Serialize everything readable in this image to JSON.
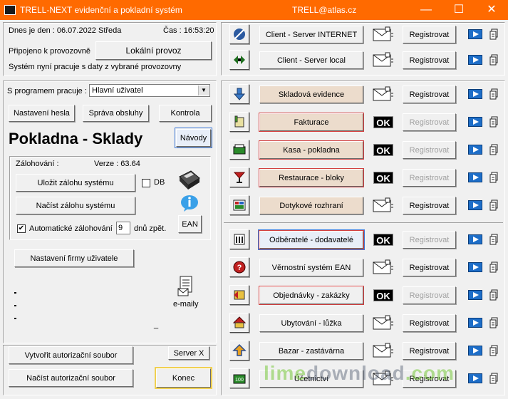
{
  "titlebar": {
    "title": "TRELL-NEXT evidenční a pokladní systém",
    "center": "TRELL@atlas.cz",
    "minimize": "—",
    "maximize": "☐",
    "close": "✕"
  },
  "status": {
    "date_label": "Dnes je den : 06.07.2022  Středa",
    "time_label": "Čas : 16:53:20",
    "connected_label": "Připojeno k provozovně",
    "connected_button": "Lokální  provoz",
    "system_note": "Systém nyní pracuje s daty z vybrané provozovny"
  },
  "program": {
    "label": "S programem pracuje :",
    "selected": "Hlavní uživatel",
    "buttons": {
      "password": "Nastavení hesla",
      "staff": "Správa obsluhy",
      "check": "Kontrola"
    }
  },
  "heading": {
    "title": "Pokladna - Sklady",
    "guides": "Návody"
  },
  "backup": {
    "label": "Zálohování :",
    "version": "Verze : 63.64",
    "save": "Uložit zálohu systému",
    "db_label": "DB",
    "load": "Načíst zálohu systému",
    "auto_label": "Automatické zálohování",
    "auto_checked": "✔",
    "days_value": "9",
    "days_suffix": "dnů zpět.",
    "ean": "EAN"
  },
  "company": {
    "settings": "Nastavení  firmy  uživatele",
    "emails": "e-maily",
    "dash": "_"
  },
  "bottom": {
    "create_auth": "Vytvořit autorizační soubor",
    "server_x": "Server X",
    "load_auth": "Načíst autorizační soubor",
    "end": "Konec"
  },
  "modules": [
    {
      "label": "Client - Server INTERNET",
      "reg": "Registrovat",
      "ok": "",
      "icon": "satellite-icon"
    },
    {
      "label": "Client - Server local",
      "reg": "Registrovat",
      "ok": "",
      "icon": "network-arrows-icon"
    },
    {
      "label": "Skladová evidence",
      "reg": "Registrovat",
      "ok": "",
      "icon": "arrow-down-icon"
    },
    {
      "label": "Fakturace",
      "reg": "Registrovat",
      "ok": "OK",
      "icon": "invoice-icon"
    },
    {
      "label": "Kasa - pokladna",
      "reg": "Registrovat",
      "ok": "OK",
      "icon": "cash-register-icon"
    },
    {
      "label": "Restaurace - bloky",
      "reg": "Registrovat",
      "ok": "OK",
      "icon": "cocktail-glass-icon"
    },
    {
      "label": "Dotykové rozhraní",
      "reg": "Registrovat",
      "ok": "",
      "icon": "touchscreen-icon"
    },
    {
      "label": "Odběratelé - dodavatelé",
      "reg": "Registrovat",
      "ok": "OK",
      "icon": "contacts-list-icon"
    },
    {
      "label": "Věrnostní systém EAN",
      "reg": "Registrovat",
      "ok": "",
      "icon": "loyalty-question-icon"
    },
    {
      "label": "Objednávky - zakázky",
      "reg": "Registrovat",
      "ok": "OK",
      "icon": "orders-icon"
    },
    {
      "label": "Ubytování - lůžka",
      "reg": "Registrovat",
      "ok": "",
      "icon": "house-icon"
    },
    {
      "label": "Bazar - zastávárna",
      "reg": "Registrovat",
      "ok": "",
      "icon": "upload-arrow-icon"
    },
    {
      "label": "Účetnictví",
      "reg": "Registrovat",
      "ok": "",
      "icon": "accounting-icon"
    }
  ],
  "watermark": {
    "part1": "lime",
    "part2": "download",
    "part3": ".com"
  }
}
